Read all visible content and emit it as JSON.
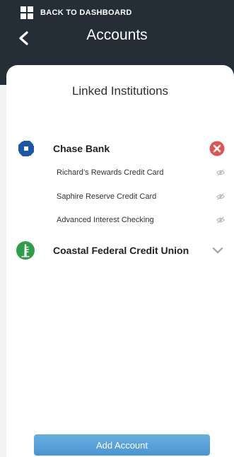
{
  "header": {
    "back_label": "BACK TO DASHBOARD",
    "title": "Accounts"
  },
  "linked": {
    "heading": "Linked Institutions",
    "institutions": [
      {
        "name": "Chase Bank",
        "logo_icon": "chase-logo-icon",
        "action_icon": "remove-icon",
        "accounts": [
          {
            "name": "Richard’s Rewards Credit Card",
            "icon": "eye-slash-icon"
          },
          {
            "name": "Saphire Reserve Credit Card",
            "icon": "eye-slash-icon"
          },
          {
            "name": "Advanced Interest Checking",
            "icon": "eye-slash-icon"
          }
        ]
      },
      {
        "name": "Coastal Federal Credit Union",
        "logo_icon": "coastal-logo-icon",
        "action_icon": "chevron-down-icon",
        "accounts": []
      }
    ]
  },
  "footer": {
    "add_label": "Add Account"
  },
  "colors": {
    "header_bg": "#252d37",
    "accent": "#4a95d1",
    "remove": "#e0534f",
    "chase_blue": "#1a57a8",
    "coastal_green": "#2f9e4b"
  }
}
